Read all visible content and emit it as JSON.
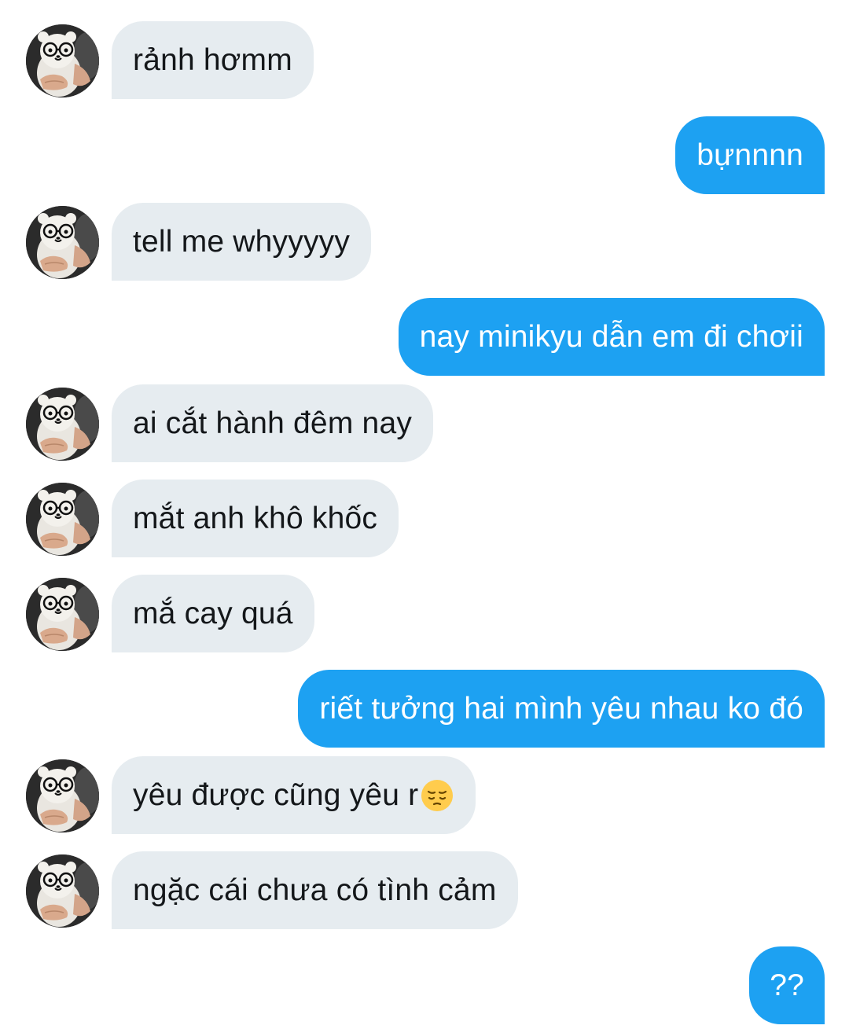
{
  "conversation": {
    "messages": [
      {
        "id": "m1",
        "direction": "incoming",
        "text": "rảnh hơmm"
      },
      {
        "id": "m2",
        "direction": "outgoing",
        "text": "bựnnnn"
      },
      {
        "id": "m3",
        "direction": "incoming",
        "text": "tell me whyyyyy"
      },
      {
        "id": "m4",
        "direction": "outgoing",
        "text": "nay minikyu dẫn em đi chơii"
      },
      {
        "id": "m5",
        "direction": "incoming",
        "text": "ai cắt hành đêm nay"
      },
      {
        "id": "m6",
        "direction": "incoming",
        "text": "mắt anh khô khốc"
      },
      {
        "id": "m7",
        "direction": "incoming",
        "text": "mắ cay quá"
      },
      {
        "id": "m8",
        "direction": "outgoing",
        "text": "riết tưởng hai mình yêu nhau ko đó"
      },
      {
        "id": "m9",
        "direction": "incoming",
        "text": "yêu được cũng yêu r",
        "emoji": "pensive-face-emoji"
      },
      {
        "id": "m10",
        "direction": "incoming",
        "text": "ngặc cái chưa có tình cảm"
      },
      {
        "id": "m11",
        "direction": "outgoing",
        "text": "??"
      }
    ]
  },
  "theme": {
    "incoming_bubble": "#e6ecf0",
    "incoming_text": "#14171a",
    "outgoing_bubble": "#1da1f2",
    "outgoing_text": "#ffffff"
  },
  "avatar": {
    "icon": "bear-with-glasses-avatar"
  }
}
